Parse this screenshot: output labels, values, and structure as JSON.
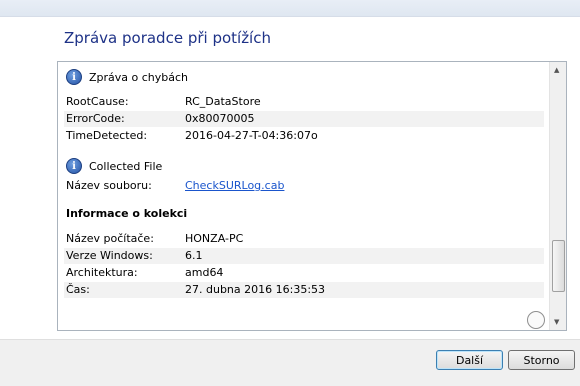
{
  "window": {
    "title": "Zpráva poradce při potížích"
  },
  "section_error": {
    "heading": "Zpráva o chybách",
    "rows": [
      {
        "label": "RootCause:",
        "value": "RC_DataStore"
      },
      {
        "label": "ErrorCode:",
        "value": "0x80070005"
      },
      {
        "label": "TimeDetected:",
        "value": "2016-04-27-T-04:36:07o"
      }
    ]
  },
  "section_file": {
    "heading": "Collected File",
    "rows": [
      {
        "label": "Název souboru:",
        "value": "CheckSURLog.cab"
      }
    ]
  },
  "section_info": {
    "heading": "Informace o kolekci",
    "rows": [
      {
        "label": "Název počítače:",
        "value": "HONZA-PC"
      },
      {
        "label": "Verze Windows:",
        "value": "6.1"
      },
      {
        "label": "Architektura:",
        "value": "amd64"
      },
      {
        "label": "Čas:",
        "value": "27. dubna 2016 16:35:53"
      }
    ]
  },
  "footer": {
    "next_label": "Další",
    "cancel_label": "Storno"
  },
  "icons": {
    "scroll_up": "▲",
    "scroll_down": "▼",
    "info": "i"
  },
  "colors": {
    "title": "#1e3287",
    "link": "#1a55cc"
  }
}
